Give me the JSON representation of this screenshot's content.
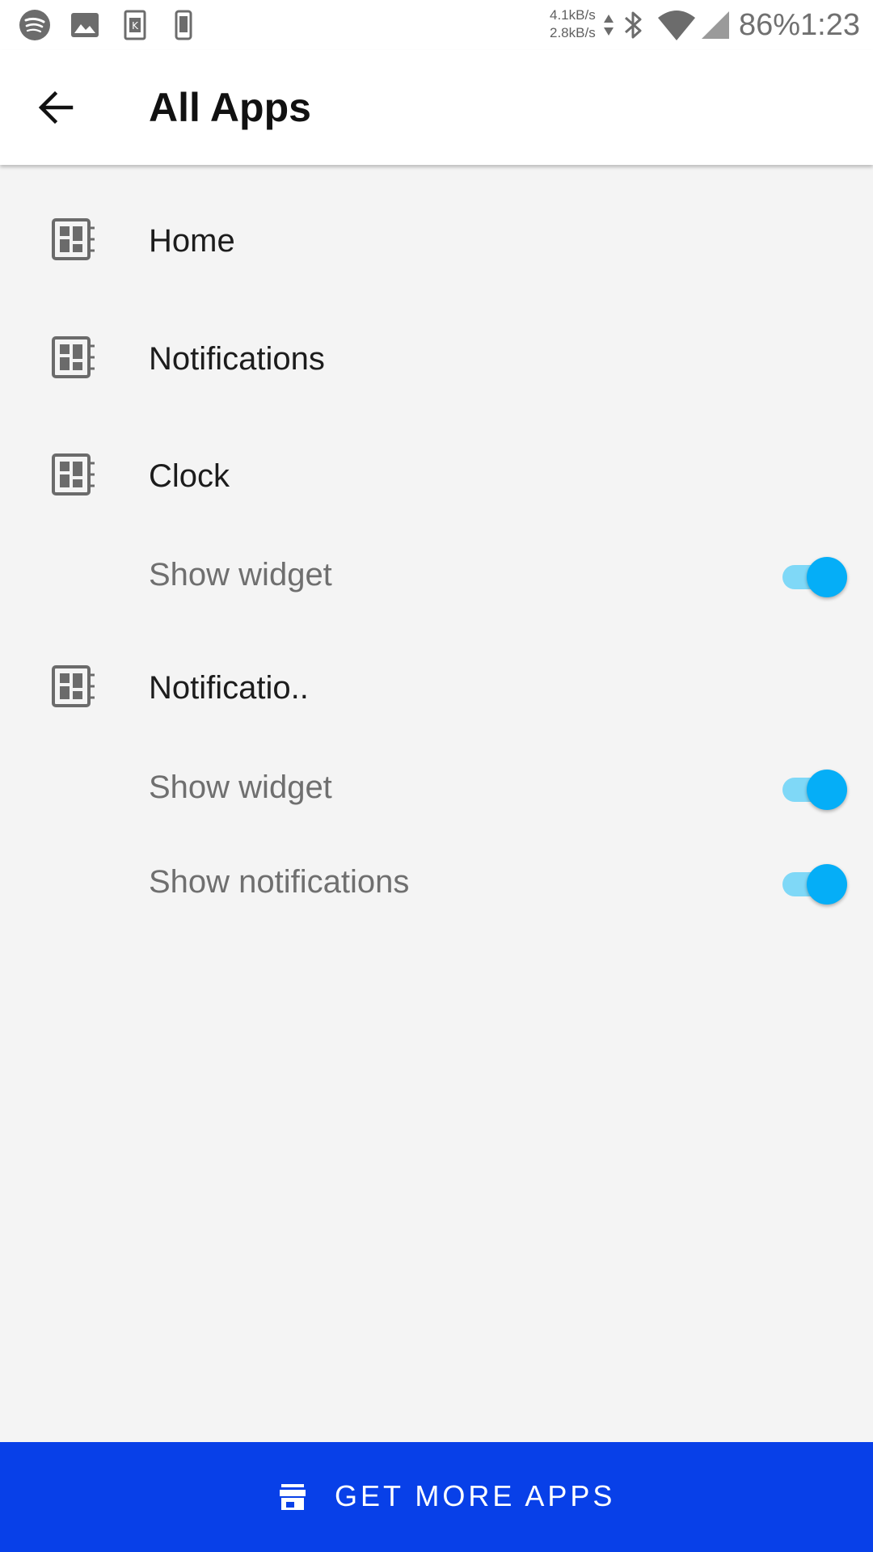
{
  "status_bar": {
    "net_up": "4.1kB/s",
    "net_down": "2.8kB/s",
    "battery": "86%",
    "time": "1:23",
    "icons": [
      "spotify-icon",
      "image-icon",
      "k-app-icon",
      "phone-icon",
      "data-arrows-icon",
      "bluetooth-icon",
      "wifi-icon",
      "signal-icon"
    ]
  },
  "app_bar": {
    "title": "All Apps",
    "back_icon": "arrow-back-icon"
  },
  "apps": [
    {
      "label": "Home",
      "icon": "dashboard-icon",
      "settings": []
    },
    {
      "label": "Notifications",
      "icon": "dashboard-icon",
      "settings": []
    },
    {
      "label": "Clock",
      "icon": "dashboard-icon",
      "settings": [
        {
          "label": "Show widget",
          "enabled": true
        }
      ]
    },
    {
      "label": "Notificatio..",
      "icon": "dashboard-icon",
      "settings": [
        {
          "label": "Show widget",
          "enabled": true
        },
        {
          "label": "Show notifications",
          "enabled": true
        }
      ]
    }
  ],
  "bottom_button": {
    "label": "GET MORE APPS",
    "icon": "store-icon"
  },
  "colors": {
    "accent": "#05aef7",
    "toggle_track": "#7fd8f7",
    "primary_button": "#0840e8",
    "background": "#f4f4f4"
  }
}
